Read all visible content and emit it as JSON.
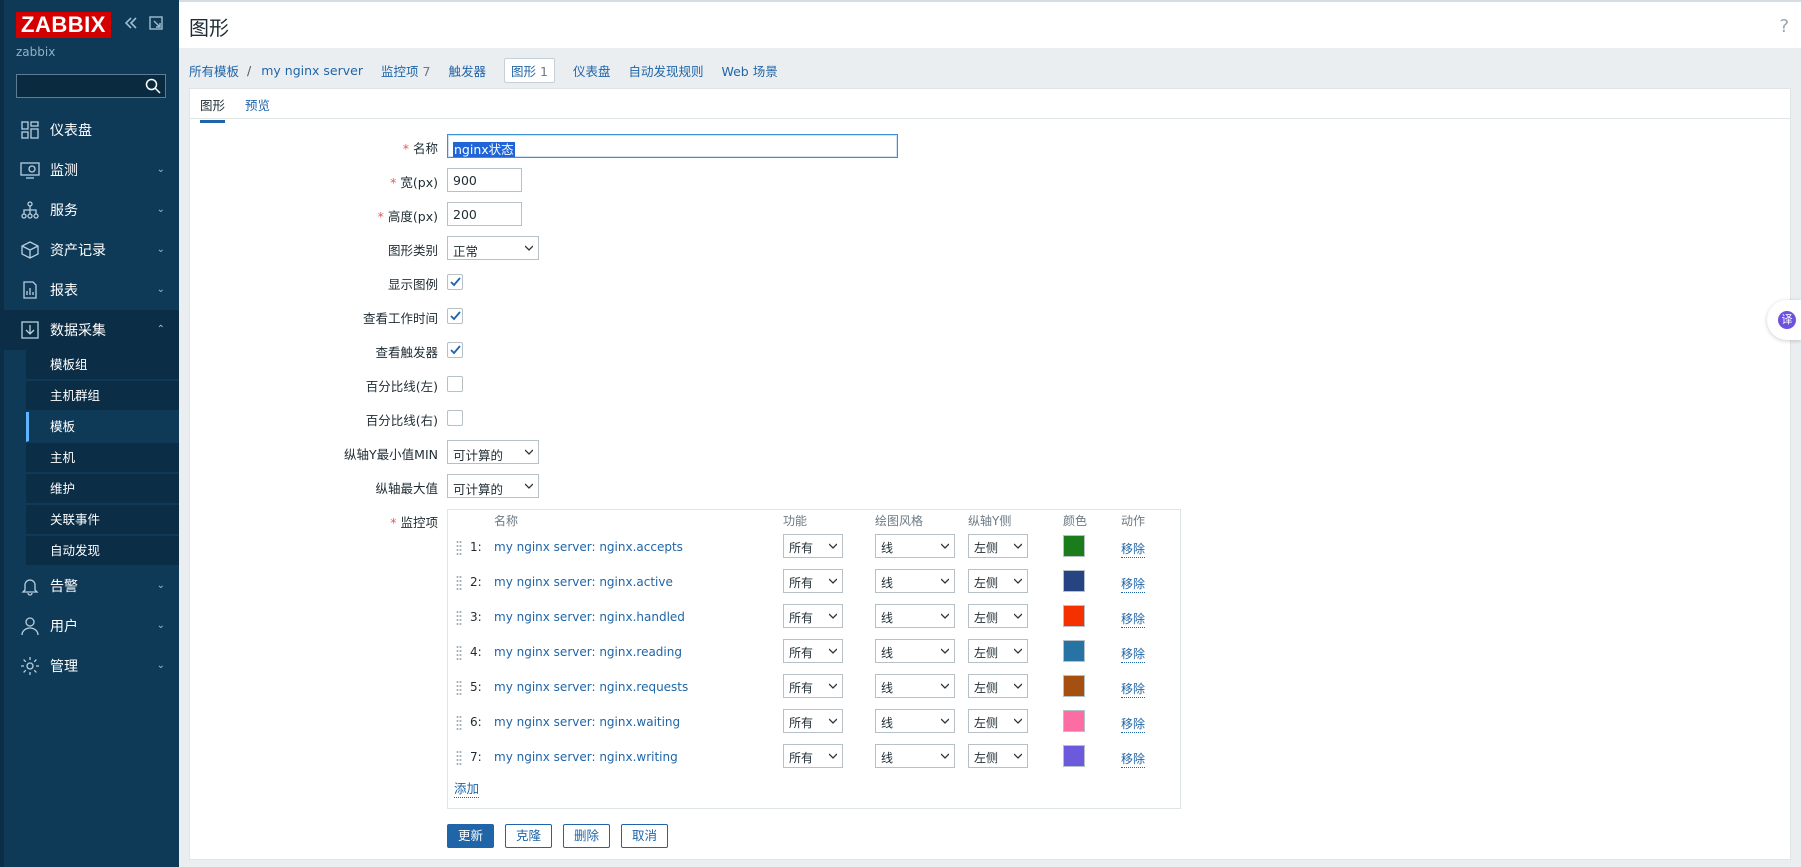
{
  "app": {
    "logo": "ZABBIX",
    "server": "zabbix",
    "search_value": ""
  },
  "nav": [
    {
      "label": "仪表盘",
      "icon": "dashboard-icon",
      "chev": ""
    },
    {
      "label": "监测",
      "icon": "monitoring-icon",
      "chev": "⌄"
    },
    {
      "label": "服务",
      "icon": "services-icon",
      "chev": "⌄"
    },
    {
      "label": "资产记录",
      "icon": "inventory-icon",
      "chev": "⌄"
    },
    {
      "label": "报表",
      "icon": "reports-icon",
      "chev": "⌄"
    },
    {
      "label": "数据采集",
      "icon": "data-collection-icon",
      "chev": "⌃"
    },
    {
      "label": "告警",
      "icon": "alerts-icon",
      "chev": "⌄"
    },
    {
      "label": "用户",
      "icon": "users-icon",
      "chev": "⌄"
    },
    {
      "label": "管理",
      "icon": "administration-icon",
      "chev": "⌄"
    }
  ],
  "subnav": [
    "模板组",
    "主机群组",
    "模板",
    "主机",
    "维护",
    "关联事件",
    "自动发现"
  ],
  "page": {
    "title": "图形",
    "help": "?"
  },
  "breadcrumbs": {
    "all_templates": "所有模板",
    "sep": "/",
    "template": "my nginx server",
    "items": "监控项",
    "items_count": "7",
    "triggers": "触发器",
    "graphs": "图形",
    "graphs_count": "1",
    "dashboards": "仪表盘",
    "discovery": "自动发现规则",
    "web": "Web 场景"
  },
  "tabs": {
    "graph": "图形",
    "preview": "预览"
  },
  "form": {
    "name_label": "名称",
    "name_value": "nginx状态",
    "width_label": "宽(px)",
    "width_value": "900",
    "height_label": "高度(px)",
    "height_value": "200",
    "type_label": "图形类别",
    "type_value": "正常",
    "legend_label": "显示图例",
    "legend_checked": true,
    "worktime_label": "查看工作时间",
    "worktime_checked": true,
    "triggers_label": "查看触发器",
    "triggers_checked": true,
    "pleft_label": "百分比线(左)",
    "pleft_checked": false,
    "pright_label": "百分比线(右)",
    "pright_checked": false,
    "ymin_label": "纵轴Y最小值MIN",
    "ymin_value": "可计算的",
    "ymax_label": "纵轴最大值",
    "ymax_value": "可计算的",
    "items_label": "监控项"
  },
  "items_table": {
    "headers": {
      "name": "名称",
      "function": "功能",
      "style": "绘图风格",
      "axis": "纵轴Y侧",
      "color": "颜色",
      "action": "动作"
    },
    "rows": [
      {
        "num": "1:",
        "name": "my nginx server: nginx.accepts",
        "function": "所有",
        "style": "线",
        "axis": "左侧",
        "color": "#1a7c1a",
        "remove": "移除"
      },
      {
        "num": "2:",
        "name": "my nginx server: nginx.active",
        "function": "所有",
        "style": "线",
        "axis": "左侧",
        "color": "#274482",
        "remove": "移除"
      },
      {
        "num": "3:",
        "name": "my nginx server: nginx.handled",
        "function": "所有",
        "style": "线",
        "axis": "左侧",
        "color": "#f63100",
        "remove": "移除"
      },
      {
        "num": "4:",
        "name": "my nginx server: nginx.reading",
        "function": "所有",
        "style": "线",
        "axis": "左侧",
        "color": "#2774a4",
        "remove": "移除"
      },
      {
        "num": "5:",
        "name": "my nginx server: nginx.requests",
        "function": "所有",
        "style": "线",
        "axis": "左侧",
        "color": "#a54f10",
        "remove": "移除"
      },
      {
        "num": "6:",
        "name": "my nginx server: nginx.waiting",
        "function": "所有",
        "style": "线",
        "axis": "左侧",
        "color": "#fc6ea3",
        "remove": "移除"
      },
      {
        "num": "7:",
        "name": "my nginx server: nginx.writing",
        "function": "所有",
        "style": "线",
        "axis": "左侧",
        "color": "#6c59dc",
        "remove": "移除"
      }
    ],
    "add": "添加"
  },
  "buttons": {
    "update": "更新",
    "clone": "克隆",
    "delete": "删除",
    "cancel": "取消"
  },
  "translate_badge": "译"
}
